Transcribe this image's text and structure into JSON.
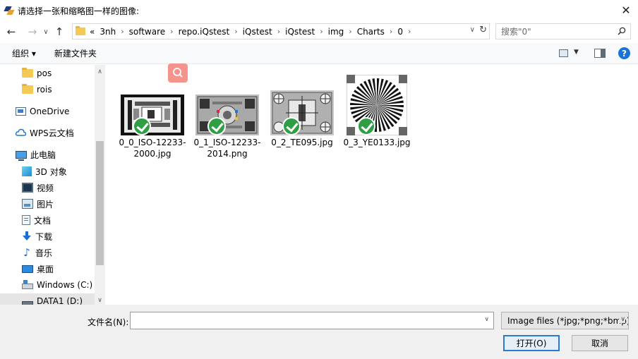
{
  "window": {
    "title": "请选择一张和缩略图一样的图像:"
  },
  "address": {
    "crumbs": [
      "«",
      "3nh",
      "software",
      "repo.iQstest",
      "iQstest",
      "iQstest",
      "img",
      "Charts",
      "0"
    ]
  },
  "search": {
    "placeholder": "搜索\"0\""
  },
  "toolbar": {
    "organize": "组织 ▾",
    "new_folder": "新建文件夹"
  },
  "sidebar": {
    "items": [
      {
        "label": "pos",
        "icon": "folder-icon",
        "indent": true
      },
      {
        "label": "rois",
        "icon": "folder-icon",
        "indent": true
      },
      {
        "label": "OneDrive",
        "icon": "onedrive-icon",
        "indent": false
      },
      {
        "label": "WPS云文档",
        "icon": "wps-cloud-icon",
        "indent": false
      },
      {
        "label": "此电脑",
        "icon": "pc-icon",
        "indent": false
      },
      {
        "label": "3D 对象",
        "icon": "3d-objects-icon",
        "indent": true
      },
      {
        "label": "视频",
        "icon": "video-icon",
        "indent": true
      },
      {
        "label": "图片",
        "icon": "pictures-icon",
        "indent": true
      },
      {
        "label": "文档",
        "icon": "documents-icon",
        "indent": true
      },
      {
        "label": "下载",
        "icon": "download-icon",
        "indent": true
      },
      {
        "label": "音乐",
        "icon": "music-icon",
        "indent": true
      },
      {
        "label": "桌面",
        "icon": "desktop-icon",
        "indent": true
      },
      {
        "label": "Windows (C:)",
        "icon": "windows-drive-icon",
        "indent": true
      },
      {
        "label": "DATA1 (D:)",
        "icon": "drive-icon",
        "indent": true,
        "selected": true
      }
    ]
  },
  "files": [
    {
      "name": "0_0_ISO-12233-2000.jpg",
      "thumb": "iso-12233-2000-chart"
    },
    {
      "name": "0_1_ISO-12233-2014.png",
      "thumb": "iso-12233-2014-chart"
    },
    {
      "name": "0_2_TE095.jpg",
      "thumb": "te095-chart"
    },
    {
      "name": "0_3_YE0133.jpg",
      "thumb": "ye0133-siemens-star"
    }
  ],
  "bottom": {
    "filename_label": "文件名(N):",
    "filename_value": "",
    "filter": "Image files  (*jpg;*png;*bmp)",
    "open": "打开(O)",
    "cancel": "取消"
  },
  "colors": {
    "accent": "#2a7ad4",
    "check": "#2f9e44",
    "float_search": "#f4948d"
  }
}
